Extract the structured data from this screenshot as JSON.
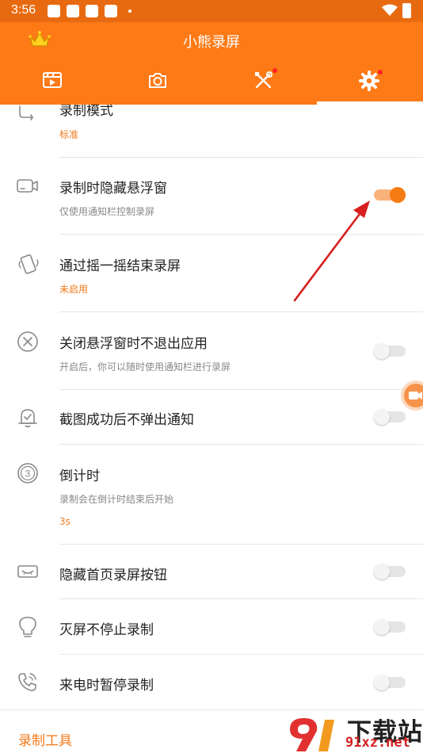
{
  "status_bar": {
    "time": "3:56"
  },
  "app": {
    "title": "小熊录屏"
  },
  "tabs": [
    {
      "name": "video-list",
      "icon": "clapperboard-icon"
    },
    {
      "name": "screenshot",
      "icon": "camera-icon"
    },
    {
      "name": "tools",
      "icon": "tools-icon",
      "badge": true
    },
    {
      "name": "settings",
      "icon": "gear-icon",
      "badge": true,
      "selected": true
    }
  ],
  "settings": [
    {
      "title": "录制模式",
      "value": "标准"
    },
    {
      "title": "录制时隐藏悬浮窗",
      "subtitle": "仅使用通知栏控制录屏",
      "toggle": true
    },
    {
      "title": "通过摇一摇结束录屏",
      "value": "未启用"
    },
    {
      "title": "关闭悬浮窗时不退出应用",
      "subtitle": "开启后，你可以随时使用通知栏进行录屏",
      "toggle": false
    },
    {
      "title": "截图成功后不弹出通知",
      "toggle": false
    },
    {
      "title": "倒计时",
      "subtitle": "录制会在倒计时结束后开始",
      "value": "3s"
    },
    {
      "title": "隐藏首页录屏按钮",
      "toggle": false
    },
    {
      "title": "灭屏不停止录制",
      "toggle": false
    },
    {
      "title": "来电时暂停录制",
      "toggle": false
    }
  ],
  "footer": {
    "label": "录制工具"
  },
  "watermark": {
    "brand": "下载站",
    "domain": "91xz.net"
  },
  "colors": {
    "accent": "#fd7a17",
    "status_bar": "#e86a10",
    "value_text": "#f07a1a",
    "annotation_arrow": "#d81e1e"
  }
}
